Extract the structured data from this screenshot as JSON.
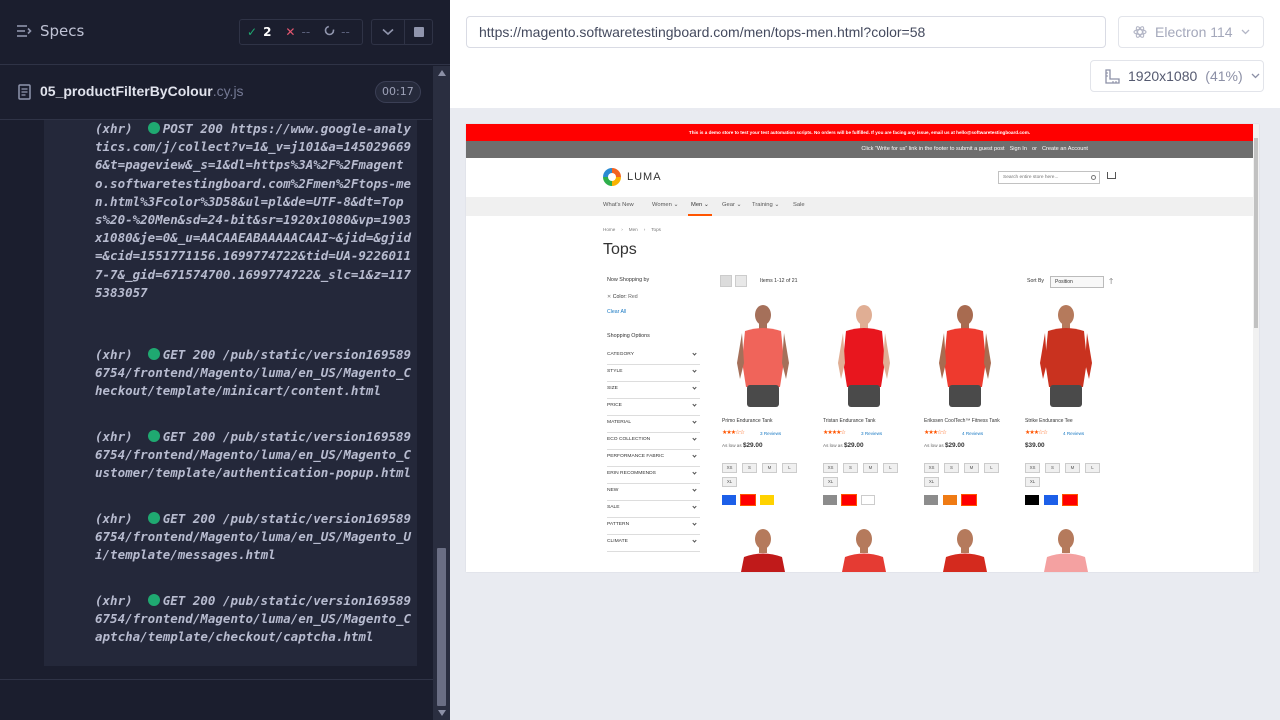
{
  "reporter": {
    "specs_label": "Specs",
    "stats": {
      "passed": "2",
      "failed": "--",
      "pending": "--"
    },
    "spec": {
      "name": "05_productFilterByColour",
      "ext": ".cy.js",
      "duration": "00:17"
    },
    "commands": [
      {
        "tag": "(xhr)",
        "method": "POST",
        "status": "200",
        "url": "https://www.google-analytics.com/j/collect?v=1&_v=j101&a=1450296696&t=pageview&_s=1&dl=https%3A%2F%2Fmagento.softwaretestingboard.com%2Fmen%2Ftops-men.html%3Fcolor%3D58&ul=pl&de=UTF-8&dt=Tops%20-%20Men&sd=24-bit&sr=1920x1080&vp=1903x1080&je=0&_u=AACAAEABAAAAACAAI~&jid=&gjid=&cid=1551771156.1699774722&tid=UA-92260117-7&_gid=671574700.1699774722&_slc=1&z=1175383057"
      },
      {
        "tag": "(xhr)",
        "method": "GET",
        "status": "200",
        "url": "/pub/static/version1695896754/frontend/Magento/luma/en_US/Magento_Checkout/template/minicart/content.html"
      },
      {
        "tag": "(xhr)",
        "method": "GET",
        "status": "200",
        "url": "/pub/static/version1695896754/frontend/Magento/luma/en_US/Magento_Customer/template/authentication-popup.html"
      },
      {
        "tag": "(xhr)",
        "method": "GET",
        "status": "200",
        "url": "/pub/static/version1695896754/frontend/Magento/luma/en_US/Magento_Ui/template/messages.html"
      },
      {
        "tag": "(xhr)",
        "method": "GET",
        "status": "200",
        "url": "/pub/static/version1695896754/frontend/Magento/luma/en_US/Magento_Captcha/template/checkout/captcha.html"
      }
    ]
  },
  "aut": {
    "url": "https://magento.softwaretestingboard.com/men/tops-men.html?color=58",
    "browser": "Electron 114",
    "viewport": "1920x1080",
    "scale": "(41%)"
  },
  "site": {
    "demo_banner": "This is a demo store to test your test automation scripts. No orders will be fulfilled. If you are facing any issue, email us at hello@softwaretestingboard.com.",
    "panel": {
      "write_for_us": "Click “Write for us” link in the footer to submit a guest post",
      "sign_in": "Sign In",
      "or": "or",
      "create_account": "Create an Account"
    },
    "logo": "LUMA",
    "search_placeholder": "Search entire store here...",
    "nav": [
      "What's New",
      "Women",
      "Men",
      "Gear",
      "Training",
      "Sale"
    ],
    "breadcrumbs": [
      "Home",
      "Men",
      "Tops"
    ],
    "title": "Tops",
    "now_shopping_by": "Now Shopping by",
    "active_filter": {
      "label": "Color:",
      "value": "Red"
    },
    "clear_all": "Clear All",
    "shopping_options": "Shopping Options",
    "filters": [
      "CATEGORY",
      "STYLE",
      "SIZE",
      "PRICE",
      "MATERIAL",
      "ECO COLLECTION",
      "PERFORMANCE FABRIC",
      "ERIN RECOMMENDS",
      "NEW",
      "SALE",
      "PATTERN",
      "CLIMATE"
    ],
    "items_count": "Items 1-12 of 21",
    "sort_by": "Sort By",
    "sort_value": "Position",
    "sizes": [
      "XS",
      "S",
      "M",
      "L",
      "XL"
    ],
    "products": [
      {
        "name": "Primo Endurance Tank",
        "stars": "★★★☆☆",
        "rating": 3,
        "reviews": "3 Reviews",
        "price_prefix": "As low as",
        "price": "$29.00",
        "shirt": "#f0645a",
        "skin": "#a5705a",
        "colors": [
          "#1c5fe8",
          "#ff0000",
          "#ffd200"
        ],
        "selected": 1
      },
      {
        "name": "Tristan Endurance Tank",
        "stars": "★★★★☆",
        "rating": 4,
        "reviews": "3 Reviews",
        "price_prefix": "As low as",
        "price": "$29.00",
        "shirt": "#e8161e",
        "skin": "#e0ae94",
        "colors": [
          "#8c8c8c",
          "#ff0000",
          "#ffffff"
        ],
        "selected": 1
      },
      {
        "name": "Erikssen CoolTech™ Fitness Tank",
        "stars": "★★★☆☆",
        "rating": 3,
        "reviews": "4 Reviews",
        "price_prefix": "As low as",
        "price": "$29.00",
        "shirt": "#ee3a2e",
        "skin": "#a86b50",
        "colors": [
          "#8c8c8c",
          "#ef7b14",
          "#ff0000"
        ],
        "selected": 2
      },
      {
        "name": "Strike Endurance Tee",
        "stars": "★★★☆☆",
        "rating": 3,
        "reviews": "4 Reviews",
        "price_prefix": "",
        "price": "$39.00",
        "shirt": "#c9321f",
        "skin": "#b57a5c",
        "colors": [
          "#000000",
          "#1c5fe8",
          "#ff0000"
        ],
        "selected": 2
      }
    ],
    "row2_colors": [
      "#c01a1a",
      "#e53b33",
      "#d42a1e",
      "#f4a1a1"
    ]
  }
}
